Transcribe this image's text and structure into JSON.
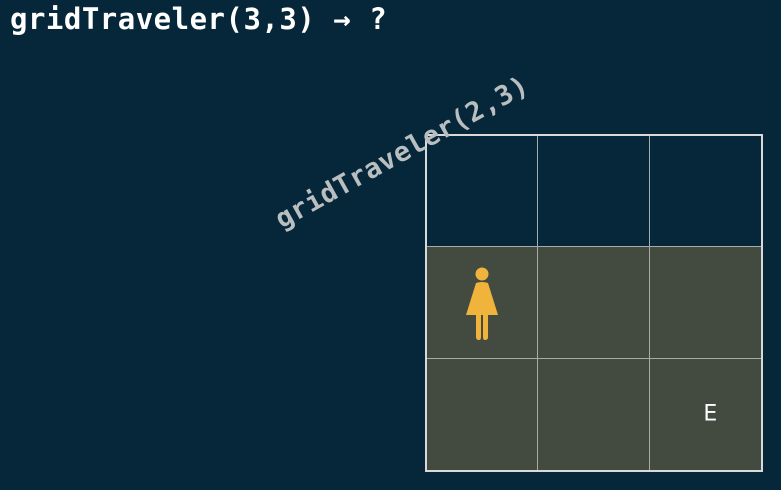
{
  "title": "gridTraveler(3,3) → ?",
  "subproblem_label": "gridTraveler(2,3)",
  "grid": {
    "rows": 3,
    "cols": 3,
    "end_label": "E",
    "traveler_icon": "woman-icon",
    "colors": {
      "background": "#06273a",
      "active_region": "#434a40",
      "border": "#d9d9d9",
      "traveler": "#f0b43c"
    }
  }
}
